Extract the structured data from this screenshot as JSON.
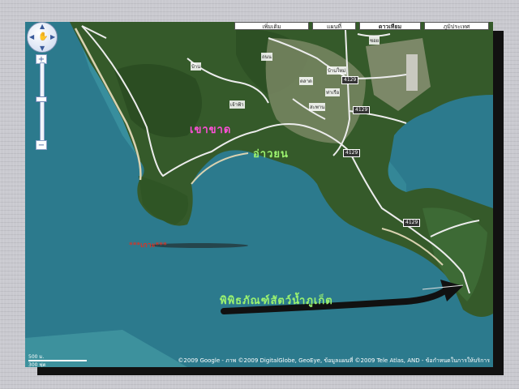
{
  "map_types": [
    "เพิ่มเติม",
    "แผนที่",
    "ดาวเทียม",
    "ภูมิประเทศ"
  ],
  "active_map_type": "ดาวเทียม",
  "labels": {
    "khao_khad": "เขาขาด",
    "ao_yon": "อ่าวยน",
    "small_red": "***เกาะ***",
    "aquarium": "พิพิธภัณฑ์สัตว์น้ำภูเก็ต"
  },
  "road_labels": [
    "ซอย",
    "บ้านใหม่",
    "ถนน",
    "ตลาด",
    "ท่าเรือ",
    "สะพาน",
    "เจ้าฟ้า",
    "บ้าน"
  ],
  "road_shields": [
    "4129",
    "4129",
    "4129",
    "4129"
  ],
  "zoom": {
    "plus": "+",
    "minus": "−"
  },
  "scale": {
    "metric": "500 ม.",
    "imperial": "300 ฟุต"
  },
  "copyright": "©2009 Google - ภาพ ©2009 DigitalGlobe, GeoEye, ข้อมูลแผนที่ ©2009 Tele Atlas, AND - ข้อกำหนดในการให้บริการ",
  "colors": {
    "sea": "#2f7c8f",
    "land": "#3b5a2f",
    "road": "#e8e8e8",
    "label_pink": "#ff4fd8",
    "label_green": "#9cf36f",
    "label_red": "#d0372b",
    "arrow": "#111111"
  }
}
